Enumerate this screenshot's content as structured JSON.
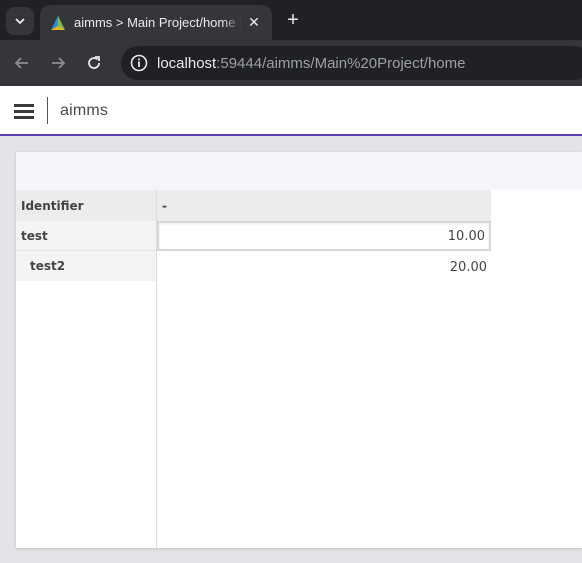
{
  "browser": {
    "tab_title": "aimms > Main Project/home | A",
    "url_host": "localhost",
    "url_rest": ":59444/aimms/Main%20Project/home"
  },
  "app": {
    "name": "aimms",
    "accent_color": "#5b3fb5"
  },
  "table": {
    "corner_label": "Identifier",
    "column_header": "-",
    "rows": [
      {
        "label": "test",
        "value": "10.00",
        "indent": 0
      },
      {
        "label": "test2",
        "value": "20.00",
        "indent": 1
      }
    ]
  }
}
